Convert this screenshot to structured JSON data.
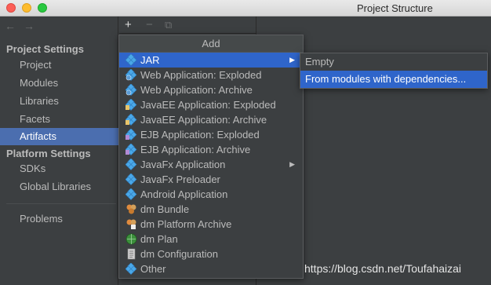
{
  "window": {
    "title": "Project Structure"
  },
  "sidebar": {
    "section_project": "Project Settings",
    "project_items": [
      {
        "label": "Project"
      },
      {
        "label": "Modules"
      },
      {
        "label": "Libraries"
      },
      {
        "label": "Facets"
      },
      {
        "label": "Artifacts",
        "selected": true
      }
    ],
    "section_platform": "Platform Settings",
    "platform_items": [
      {
        "label": "SDKs"
      },
      {
        "label": "Global Libraries"
      }
    ],
    "problems": "Problems"
  },
  "toolbar": {
    "add": "+",
    "remove": "−",
    "copy": "⧉"
  },
  "popup": {
    "title": "Add",
    "items": [
      {
        "label": "JAR",
        "icon": "diamond-icon",
        "submenu": true,
        "selected": true
      },
      {
        "label": "Web Application: Exploded",
        "icon": "web-diamond-icon"
      },
      {
        "label": "Web Application: Archive",
        "icon": "web-diamond-icon"
      },
      {
        "label": "JavaEE Application: Exploded",
        "icon": "javaee-diamond-icon"
      },
      {
        "label": "JavaEE Application: Archive",
        "icon": "javaee-diamond-icon"
      },
      {
        "label": "EJB Application: Exploded",
        "icon": "ejb-diamond-icon"
      },
      {
        "label": "EJB Application: Archive",
        "icon": "ejb-diamond-icon"
      },
      {
        "label": "JavaFx Application",
        "icon": "diamond-icon",
        "submenu": true
      },
      {
        "label": "JavaFx Preloader",
        "icon": "diamond-icon"
      },
      {
        "label": "Android Application",
        "icon": "diamond-icon"
      },
      {
        "label": "dm Bundle",
        "icon": "bundle-icon"
      },
      {
        "label": "dm Platform Archive",
        "icon": "platform-archive-icon"
      },
      {
        "label": "dm Plan",
        "icon": "plan-globe-icon"
      },
      {
        "label": "dm Configuration",
        "icon": "document-icon"
      },
      {
        "label": "Other",
        "icon": "diamond-icon"
      }
    ]
  },
  "submenu": {
    "items": [
      {
        "label": "Empty"
      },
      {
        "label": "From modules with dependencies...",
        "selected": true
      }
    ]
  },
  "watermark": "https://blog.csdn.net/Toufahaizai",
  "colors": {
    "background": "#3c3f41",
    "selection": "#4b6eaf",
    "menu_selection": "#2f65ca",
    "text": "#bbbbbb"
  }
}
